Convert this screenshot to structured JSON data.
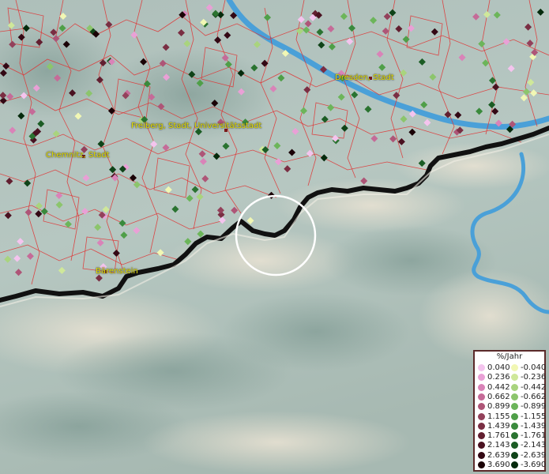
{
  "map": {
    "cities": [
      {
        "name": "Dresden, Stadt"
      },
      {
        "name": "Freiberg, Stadt, Universitätsstadt"
      },
      {
        "name": "Chemnitz, Stadt"
      },
      {
        "name": "Bärenstein"
      }
    ]
  },
  "legend": {
    "title": "%/Jahr",
    "positive": [
      {
        "value": "0.040",
        "color": "#f4c4ee"
      },
      {
        "value": "0.236",
        "color": "#e9a0d6"
      },
      {
        "value": "0.442",
        "color": "#d983b8"
      },
      {
        "value": "0.662",
        "color": "#c56b98"
      },
      {
        "value": "0.899",
        "color": "#ae5577"
      },
      {
        "value": "1.155",
        "color": "#93415b"
      },
      {
        "value": "1.439",
        "color": "#7a2e43"
      },
      {
        "value": "1.761",
        "color": "#621f30"
      },
      {
        "value": "2.143",
        "color": "#4a1221"
      },
      {
        "value": "2.639",
        "color": "#330814"
      },
      {
        "value": "3.690",
        "color": "#1a0206"
      }
    ],
    "negative": [
      {
        "value": "-0.040",
        "color": "#f1f7b4"
      },
      {
        "value": "-0.236",
        "color": "#cfe89a"
      },
      {
        "value": "-0.442",
        "color": "#a9d47e"
      },
      {
        "value": "-0.662",
        "color": "#8cc56c"
      },
      {
        "value": "-0.899",
        "color": "#6cb55a"
      },
      {
        "value": "-1.155",
        "color": "#4f9f48"
      },
      {
        "value": "-1.439",
        "color": "#3a8a3c"
      },
      {
        "value": "-1.761",
        "color": "#2a7330"
      },
      {
        "value": "-2.143",
        "color": "#1b5c24"
      },
      {
        "value": "-2.639",
        "color": "#0f4318"
      },
      {
        "value": "-3.690",
        "color": "#052a0c"
      }
    ]
  },
  "colors": {
    "district_lines": "#e03030",
    "border": "#111111",
    "river": "#4aa0d8",
    "city_label": "#e6e000",
    "highlight_circle": "#ffffff"
  }
}
